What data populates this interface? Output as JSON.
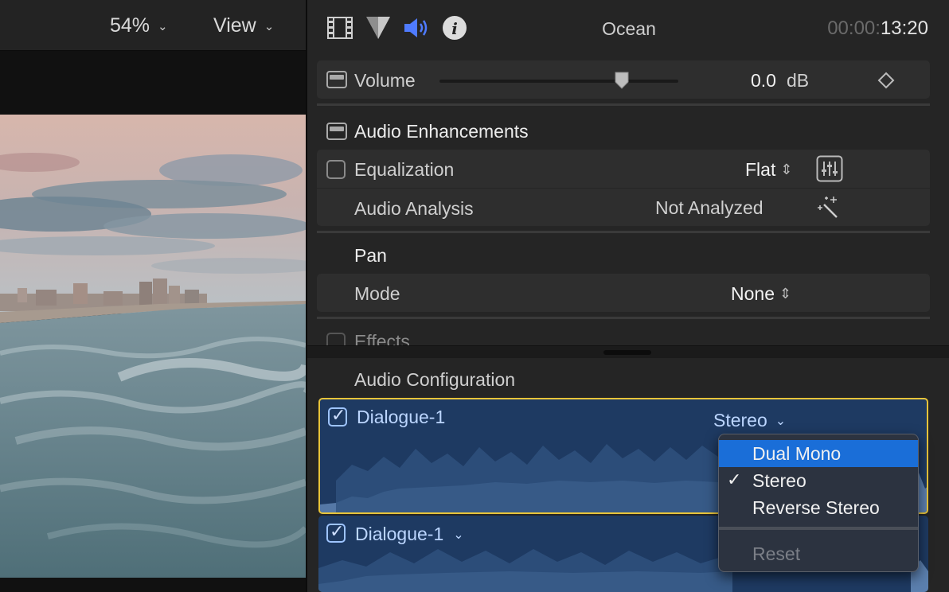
{
  "viewer": {
    "zoom_label": "54%",
    "view_label": "View"
  },
  "inspector": {
    "tabs": [
      {
        "name": "video-inspector-icon"
      },
      {
        "name": "color-inspector-icon"
      },
      {
        "name": "audio-inspector-icon",
        "active": true
      },
      {
        "name": "info-inspector-icon"
      }
    ],
    "clip_name": "Ocean",
    "timecode_dim": "00:00:",
    "timecode_bright": "13:20",
    "volume": {
      "label": "Volume",
      "value": "0.0",
      "unit": "dB",
      "level": 0.77
    },
    "audio_enhancements": {
      "title": "Audio Enhancements",
      "equalization": {
        "label": "Equalization",
        "value": "Flat",
        "checked": false
      },
      "analysis": {
        "label": "Audio Analysis",
        "value": "Not Analyzed"
      }
    },
    "pan": {
      "title": "Pan",
      "mode_label": "Mode",
      "mode_value": "None"
    },
    "effects": {
      "label": "Effects"
    },
    "audio_configuration": {
      "title": "Audio Configuration",
      "roles": [
        {
          "name": "Dialogue-1",
          "channel": "Stereo",
          "checked": true,
          "selected": true
        },
        {
          "name": "Dialogue-1",
          "checked": true,
          "selected": false
        }
      ]
    },
    "channel_menu": {
      "items": [
        {
          "label": "Dual Mono",
          "highlighted": true,
          "checked": false
        },
        {
          "label": "Stereo",
          "highlighted": false,
          "checked": true
        },
        {
          "label": "Reverse Stereo",
          "highlighted": false,
          "checked": false
        }
      ],
      "reset_label": "Reset"
    }
  },
  "colors": {
    "accent_blue": "#1a6ed8",
    "selection_yellow": "#e8c43a",
    "role_fill": "#1e3a62"
  }
}
